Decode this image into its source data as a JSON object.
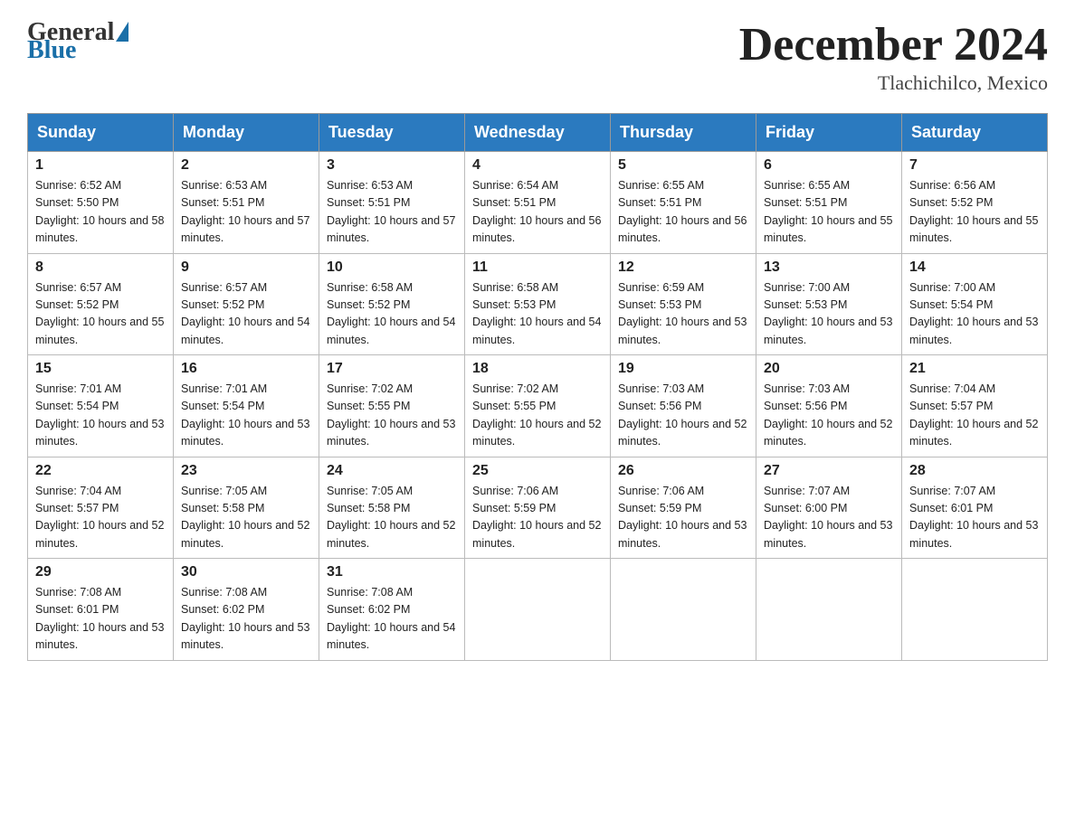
{
  "header": {
    "logo": {
      "general": "General",
      "blue": "Blue"
    },
    "title": "December 2024",
    "location": "Tlachichilco, Mexico"
  },
  "weekdays": [
    "Sunday",
    "Monday",
    "Tuesday",
    "Wednesday",
    "Thursday",
    "Friday",
    "Saturday"
  ],
  "weeks": [
    [
      {
        "day": 1,
        "sunrise": "6:52 AM",
        "sunset": "5:50 PM",
        "daylight": "10 hours and 58 minutes."
      },
      {
        "day": 2,
        "sunrise": "6:53 AM",
        "sunset": "5:51 PM",
        "daylight": "10 hours and 57 minutes."
      },
      {
        "day": 3,
        "sunrise": "6:53 AM",
        "sunset": "5:51 PM",
        "daylight": "10 hours and 57 minutes."
      },
      {
        "day": 4,
        "sunrise": "6:54 AM",
        "sunset": "5:51 PM",
        "daylight": "10 hours and 56 minutes."
      },
      {
        "day": 5,
        "sunrise": "6:55 AM",
        "sunset": "5:51 PM",
        "daylight": "10 hours and 56 minutes."
      },
      {
        "day": 6,
        "sunrise": "6:55 AM",
        "sunset": "5:51 PM",
        "daylight": "10 hours and 55 minutes."
      },
      {
        "day": 7,
        "sunrise": "6:56 AM",
        "sunset": "5:52 PM",
        "daylight": "10 hours and 55 minutes."
      }
    ],
    [
      {
        "day": 8,
        "sunrise": "6:57 AM",
        "sunset": "5:52 PM",
        "daylight": "10 hours and 55 minutes."
      },
      {
        "day": 9,
        "sunrise": "6:57 AM",
        "sunset": "5:52 PM",
        "daylight": "10 hours and 54 minutes."
      },
      {
        "day": 10,
        "sunrise": "6:58 AM",
        "sunset": "5:52 PM",
        "daylight": "10 hours and 54 minutes."
      },
      {
        "day": 11,
        "sunrise": "6:58 AM",
        "sunset": "5:53 PM",
        "daylight": "10 hours and 54 minutes."
      },
      {
        "day": 12,
        "sunrise": "6:59 AM",
        "sunset": "5:53 PM",
        "daylight": "10 hours and 53 minutes."
      },
      {
        "day": 13,
        "sunrise": "7:00 AM",
        "sunset": "5:53 PM",
        "daylight": "10 hours and 53 minutes."
      },
      {
        "day": 14,
        "sunrise": "7:00 AM",
        "sunset": "5:54 PM",
        "daylight": "10 hours and 53 minutes."
      }
    ],
    [
      {
        "day": 15,
        "sunrise": "7:01 AM",
        "sunset": "5:54 PM",
        "daylight": "10 hours and 53 minutes."
      },
      {
        "day": 16,
        "sunrise": "7:01 AM",
        "sunset": "5:54 PM",
        "daylight": "10 hours and 53 minutes."
      },
      {
        "day": 17,
        "sunrise": "7:02 AM",
        "sunset": "5:55 PM",
        "daylight": "10 hours and 53 minutes."
      },
      {
        "day": 18,
        "sunrise": "7:02 AM",
        "sunset": "5:55 PM",
        "daylight": "10 hours and 52 minutes."
      },
      {
        "day": 19,
        "sunrise": "7:03 AM",
        "sunset": "5:56 PM",
        "daylight": "10 hours and 52 minutes."
      },
      {
        "day": 20,
        "sunrise": "7:03 AM",
        "sunset": "5:56 PM",
        "daylight": "10 hours and 52 minutes."
      },
      {
        "day": 21,
        "sunrise": "7:04 AM",
        "sunset": "5:57 PM",
        "daylight": "10 hours and 52 minutes."
      }
    ],
    [
      {
        "day": 22,
        "sunrise": "7:04 AM",
        "sunset": "5:57 PM",
        "daylight": "10 hours and 52 minutes."
      },
      {
        "day": 23,
        "sunrise": "7:05 AM",
        "sunset": "5:58 PM",
        "daylight": "10 hours and 52 minutes."
      },
      {
        "day": 24,
        "sunrise": "7:05 AM",
        "sunset": "5:58 PM",
        "daylight": "10 hours and 52 minutes."
      },
      {
        "day": 25,
        "sunrise": "7:06 AM",
        "sunset": "5:59 PM",
        "daylight": "10 hours and 52 minutes."
      },
      {
        "day": 26,
        "sunrise": "7:06 AM",
        "sunset": "5:59 PM",
        "daylight": "10 hours and 53 minutes."
      },
      {
        "day": 27,
        "sunrise": "7:07 AM",
        "sunset": "6:00 PM",
        "daylight": "10 hours and 53 minutes."
      },
      {
        "day": 28,
        "sunrise": "7:07 AM",
        "sunset": "6:01 PM",
        "daylight": "10 hours and 53 minutes."
      }
    ],
    [
      {
        "day": 29,
        "sunrise": "7:08 AM",
        "sunset": "6:01 PM",
        "daylight": "10 hours and 53 minutes."
      },
      {
        "day": 30,
        "sunrise": "7:08 AM",
        "sunset": "6:02 PM",
        "daylight": "10 hours and 53 minutes."
      },
      {
        "day": 31,
        "sunrise": "7:08 AM",
        "sunset": "6:02 PM",
        "daylight": "10 hours and 54 minutes."
      },
      null,
      null,
      null,
      null
    ]
  ]
}
